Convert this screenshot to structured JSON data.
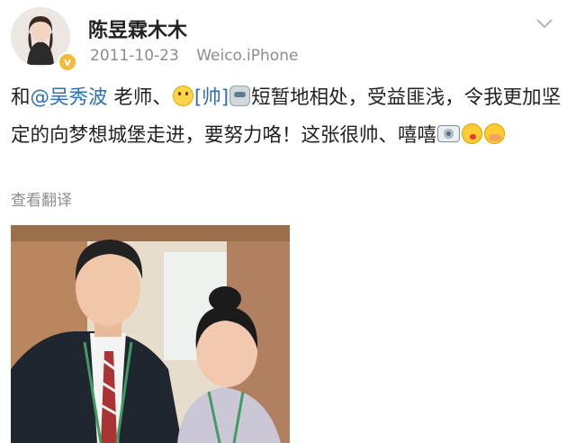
{
  "post": {
    "username": "陈昱霖木木",
    "date": "2011-10-23",
    "source": "Weico.iPhone",
    "verified_badge": "v",
    "text": {
      "part1": "和",
      "mention": "@吴秀波",
      "part2": " 老师、",
      "bracket_emote": "[帅]",
      "part3": "短暂地相处，受益匪浅，令我更加坚定的向梦想城堡走进，要努力咯！这张很帅、嘻嘻"
    },
    "emoticons": [
      "smile-emoji",
      "robot-emoji",
      "camera-emoji",
      "kiss-emoji",
      "cover-mouth-emoji"
    ],
    "translate_label": "查看翻译",
    "icons": [
      "chevron-down-icon"
    ],
    "photo_colors": {
      "curtain": "#b9865f",
      "wall": "#e7ddcc",
      "suit": "#1f2630",
      "lanyard": "#3f9d63"
    }
  }
}
